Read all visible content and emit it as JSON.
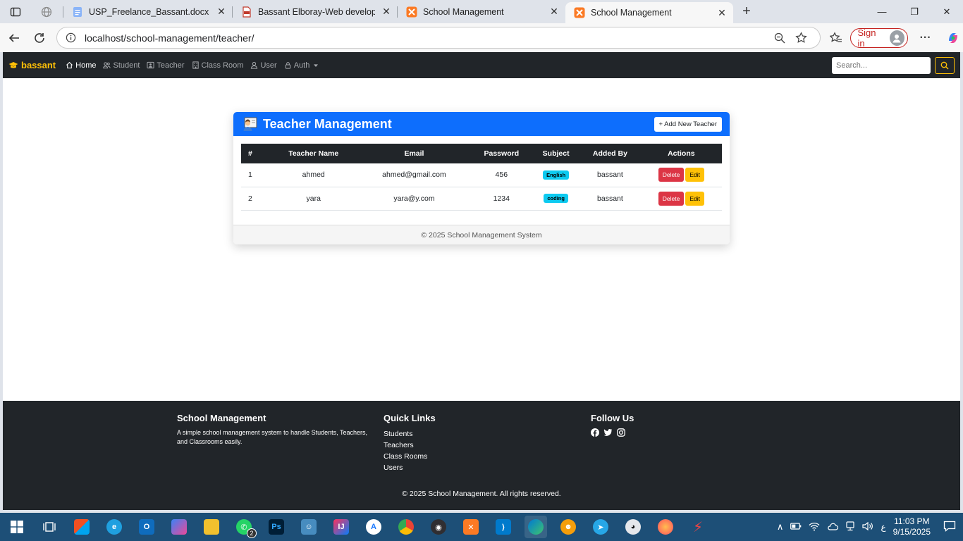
{
  "browser": {
    "tabs": [
      {
        "title": "",
        "icon": "globe-icon",
        "active": false
      },
      {
        "title": "USP_Freelance_Bassant.docx - ال...",
        "icon": "docs-icon",
        "active": false
      },
      {
        "title": "Bassant Elboray-Web developer.p...",
        "icon": "pdf-icon",
        "active": false
      },
      {
        "title": "School Management",
        "icon": "xampp-icon",
        "active": false
      },
      {
        "title": "School Management",
        "icon": "xampp-icon",
        "active": true
      }
    ],
    "url": "localhost/school-management/teacher/",
    "signin_label": "Sign in"
  },
  "nav": {
    "brand": "bassant",
    "links": [
      "Home",
      "Student",
      "Teacher",
      "Class Room",
      "User",
      "Auth"
    ],
    "search_placeholder": "Search..."
  },
  "card": {
    "title": "Teacher Management",
    "add_button": "+ Add New Teacher",
    "columns": [
      "#",
      "Teacher Name",
      "Email",
      "Password",
      "Subject",
      "Added By",
      "Actions"
    ],
    "rows": [
      {
        "id": "1",
        "name": "ahmed",
        "email": "ahmed@gmail.com",
        "password": "456",
        "subject": "English",
        "added_by": "bassant"
      },
      {
        "id": "2",
        "name": "yara",
        "email": "yara@y.com",
        "password": "1234",
        "subject": "coding",
        "added_by": "bassant"
      }
    ],
    "delete_label": "Delete",
    "edit_label": "Edit",
    "footer": "© 2025 School Management System"
  },
  "footer": {
    "about_title": "School Management",
    "about_text": "A simple school management system to handle Students, Teachers, and Classrooms easily.",
    "links_title": "Quick Links",
    "links": [
      "Students",
      "Teachers",
      "Class Rooms",
      "Users"
    ],
    "follow_title": "Follow Us",
    "copyright": "© 2025 School Management. All rights reserved."
  },
  "taskbar": {
    "whatsapp_badge": "2",
    "lang": "ع",
    "time": "11:03 PM",
    "date": "9/15/2025"
  },
  "colors": {
    "primary": "#0d6efd",
    "dark": "#212529",
    "warning": "#ffc107",
    "danger": "#dc3545",
    "info": "#0dcaf0"
  }
}
